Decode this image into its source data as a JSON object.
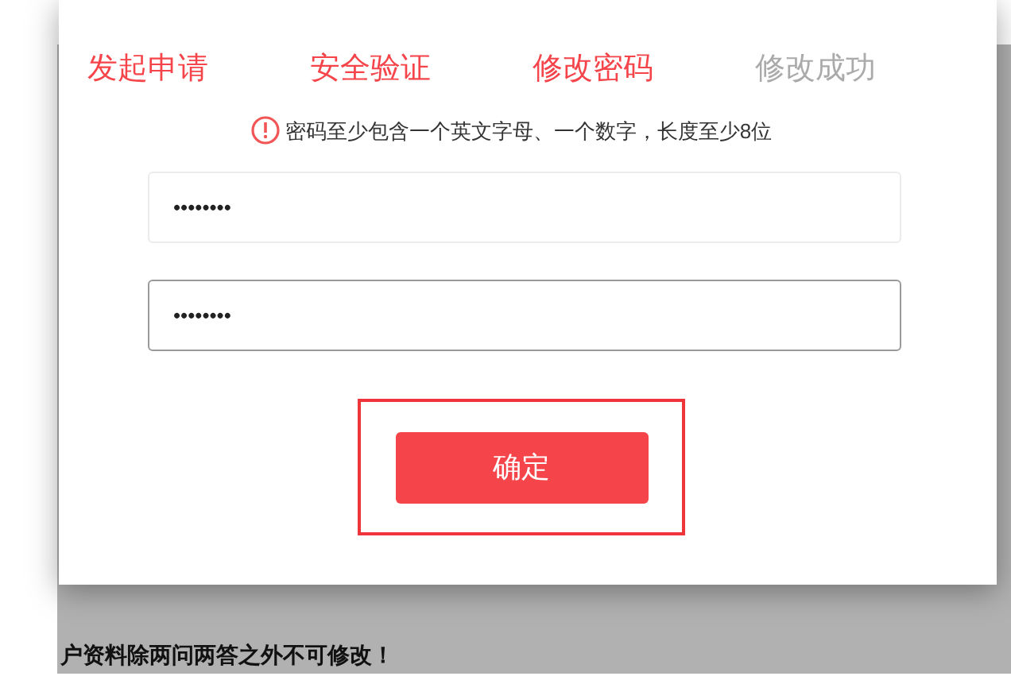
{
  "steps": [
    {
      "label": "发起申请",
      "done": true
    },
    {
      "label": "安全验证",
      "done": true
    },
    {
      "label": "修改密码",
      "done": true
    },
    {
      "label": "修改成功",
      "done": false
    }
  ],
  "hint": "密码至少包含一个英文字母、一个数字，长度至少8位",
  "fields": [
    {
      "value": "••••••••",
      "focused": false
    },
    {
      "value": "••••••••",
      "focused": true
    }
  ],
  "confirm_button": "确定",
  "background_notice": "户资料除两问两答之外不可修改！"
}
